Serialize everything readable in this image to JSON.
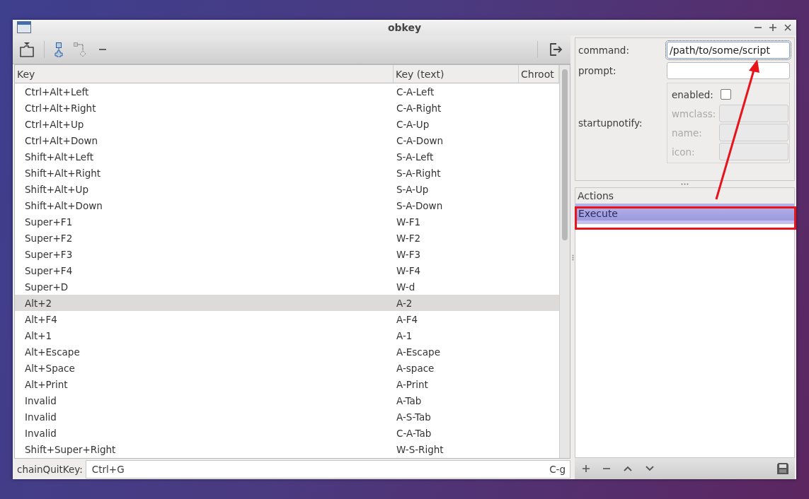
{
  "window": {
    "title": "obkey"
  },
  "table": {
    "columns": [
      "Key",
      "Key (text)",
      "Chroot"
    ],
    "rows": [
      {
        "key": "Ctrl+Alt+Left",
        "text": "C-A-Left",
        "selected": false
      },
      {
        "key": "Ctrl+Alt+Right",
        "text": "C-A-Right",
        "selected": false
      },
      {
        "key": "Ctrl+Alt+Up",
        "text": "C-A-Up",
        "selected": false
      },
      {
        "key": "Ctrl+Alt+Down",
        "text": "C-A-Down",
        "selected": false
      },
      {
        "key": "Shift+Alt+Left",
        "text": "S-A-Left",
        "selected": false
      },
      {
        "key": "Shift+Alt+Right",
        "text": "S-A-Right",
        "selected": false
      },
      {
        "key": "Shift+Alt+Up",
        "text": "S-A-Up",
        "selected": false
      },
      {
        "key": "Shift+Alt+Down",
        "text": "S-A-Down",
        "selected": false
      },
      {
        "key": "Super+F1",
        "text": "W-F1",
        "selected": false
      },
      {
        "key": "Super+F2",
        "text": "W-F2",
        "selected": false
      },
      {
        "key": "Super+F3",
        "text": "W-F3",
        "selected": false
      },
      {
        "key": "Super+F4",
        "text": "W-F4",
        "selected": false
      },
      {
        "key": "Super+D",
        "text": "W-d",
        "selected": false
      },
      {
        "key": "Alt+2",
        "text": "A-2",
        "selected": true
      },
      {
        "key": "Alt+F4",
        "text": "A-F4",
        "selected": false
      },
      {
        "key": "Alt+1",
        "text": "A-1",
        "selected": false
      },
      {
        "key": "Alt+Escape",
        "text": "A-Escape",
        "selected": false
      },
      {
        "key": "Alt+Space",
        "text": "A-space",
        "selected": false
      },
      {
        "key": "Alt+Print",
        "text": "A-Print",
        "selected": false
      },
      {
        "key": "Invalid",
        "text": "A-Tab",
        "selected": false
      },
      {
        "key": "Invalid",
        "text": "A-S-Tab",
        "selected": false
      },
      {
        "key": "Invalid",
        "text": "C-A-Tab",
        "selected": false
      },
      {
        "key": "Shift+Super+Right",
        "text": "W-S-Right",
        "selected": false
      }
    ]
  },
  "chain_quit_key": {
    "label": "chainQuitKey:",
    "value": "Ctrl+G",
    "text": "C-g"
  },
  "options": {
    "command": {
      "label": "command:",
      "value": "/path/to/some/script"
    },
    "prompt": {
      "label": "prompt:"
    },
    "startupnotify": {
      "label": "startupnotify:",
      "enabled_label": "enabled:",
      "enabled": false,
      "fields": [
        {
          "label": "wmclass:",
          "disabled": true
        },
        {
          "label": "name:",
          "disabled": true
        },
        {
          "label": "icon:",
          "disabled": true
        }
      ]
    }
  },
  "actions": {
    "title": "Actions",
    "items": [
      {
        "label": "Execute",
        "selected": true
      }
    ]
  }
}
